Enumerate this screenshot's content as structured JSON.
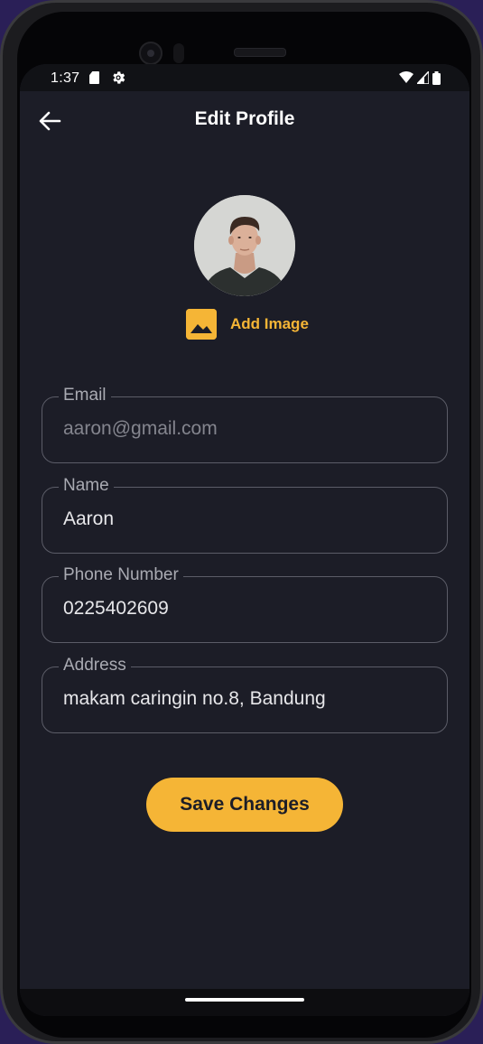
{
  "status_bar": {
    "time": "1:37",
    "icons": [
      "sd-card-icon",
      "settings-gear-icon",
      "wifi-icon",
      "signal-icon",
      "battery-icon"
    ]
  },
  "header": {
    "title": "Edit Profile",
    "back_icon": "arrow-left-icon"
  },
  "profile": {
    "add_image_label": "Add Image",
    "add_image_icon": "image-icon"
  },
  "form": {
    "email": {
      "label": "Email",
      "placeholder": "aaron@gmail.com",
      "value": ""
    },
    "name": {
      "label": "Name",
      "value": "Aaron"
    },
    "phone": {
      "label": "Phone Number",
      "value": "0225402609"
    },
    "address": {
      "label": "Address",
      "value": "makam caringin no.8, Bandung"
    }
  },
  "actions": {
    "save_label": "Save Changes"
  },
  "colors": {
    "background": "#1c1d27",
    "accent": "#f5b536",
    "field_border": "#5c5d68",
    "text_primary": "#ffffff",
    "text_muted": "#a9aab2"
  }
}
